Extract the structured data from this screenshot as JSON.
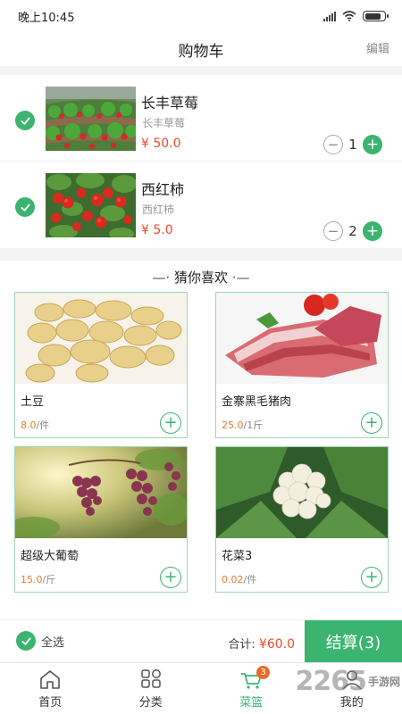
{
  "status_bar": {
    "time": "晚上10:45"
  },
  "header": {
    "title": "购物车",
    "edit_label": "编辑"
  },
  "cart_items": [
    {
      "name": "长丰草莓",
      "subtitle": "长丰草莓",
      "price": "¥ 50.0",
      "quantity": "1",
      "checked": true,
      "image": "strawberry-field-photo"
    },
    {
      "name": "西红柿",
      "subtitle": "西红柿",
      "price": "¥ 5.0",
      "quantity": "2",
      "checked": true,
      "image": "tomato-plant-photo"
    }
  ],
  "stepper": {
    "minus": "−",
    "plus": "+"
  },
  "recommend": {
    "title": "猜你喜欢",
    "left_mark": "—·",
    "right_mark": "·—",
    "products": [
      {
        "name": "土豆",
        "price": "8.0",
        "unit": "/件",
        "image": "potato-photo"
      },
      {
        "name": "金寨黑毛猪肉",
        "price": "25.0",
        "unit": "/1斤",
        "image": "pork-photo"
      },
      {
        "name": "超级大葡萄",
        "price": "15.0",
        "unit": "/斤",
        "image": "grape-photo"
      },
      {
        "name": "花菜3",
        "price": "0.02",
        "unit": "/件",
        "image": "cauliflower-photo"
      }
    ],
    "add_symbol": "+"
  },
  "checkout": {
    "select_all_label": "全选",
    "total_label": "合计:",
    "total_amount": "¥60.0",
    "button_label": "结算(3)"
  },
  "tabbar": {
    "tabs": [
      {
        "label": "首页",
        "icon": "home-icon",
        "active": false
      },
      {
        "label": "分类",
        "icon": "category-icon",
        "active": false
      },
      {
        "label": "菜篮",
        "icon": "basket-icon",
        "active": true,
        "badge": "3"
      },
      {
        "label": "我的",
        "icon": "user-icon",
        "active": false
      }
    ]
  },
  "watermark": {
    "brand": "2265",
    "sub": "手游网"
  },
  "colors": {
    "accent": "#3bb470",
    "price": "#e84a2a",
    "badge": "#e86a2a",
    "unit_price": "#e07b2a"
  }
}
